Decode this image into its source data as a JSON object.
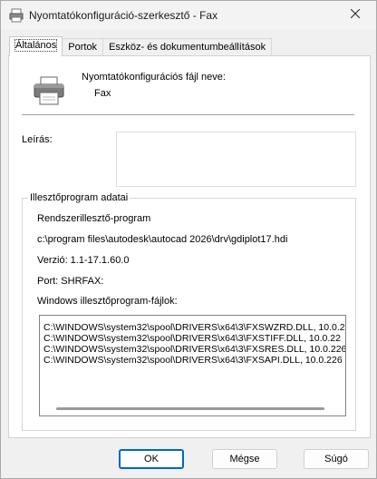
{
  "window": {
    "title": "Nyomtatókonfiguráció-szerkesztő - Fax"
  },
  "tabs": [
    {
      "label": "Általános"
    },
    {
      "label": "Portok"
    },
    {
      "label": "Eszköz- és dokumentumbeállítások"
    }
  ],
  "general": {
    "file_name_label": "Nyomtatókonfigurációs fájl neve:",
    "file_name_value": "Fax",
    "description_label": "Leírás:",
    "description_value": ""
  },
  "driver_group": {
    "title": "Illesztőprogram adatai",
    "driver_type": "Rendszerillesztő-program",
    "driver_path": "c:\\program files\\autodesk\\autocad 2026\\drv\\gdiplot17.hdi",
    "version": "Verzió: 1.1-17.1.60.0",
    "port": "Port: SHRFAX:",
    "files_label": "Windows illesztőprogram-fájlok:",
    "files": [
      "C:\\WINDOWS\\system32\\spool\\DRIVERS\\x64\\3\\FXSWZRD.DLL, 10.0.2",
      "C:\\WINDOWS\\system32\\spool\\DRIVERS\\x64\\3\\FXSTIFF.DLL, 10.0.22",
      "C:\\WINDOWS\\system32\\spool\\DRIVERS\\x64\\3\\FXSRES.DLL, 10.0.226",
      "C:\\WINDOWS\\system32\\spool\\DRIVERS\\x64\\3\\FXSAPI.DLL, 10.0.226"
    ]
  },
  "buttons": {
    "ok": "OK",
    "cancel": "Mégse",
    "help": "Súgó"
  },
  "icons": {
    "title": "printer-config-icon",
    "close": "close-icon",
    "printer": "printer-icon"
  },
  "colors": {
    "accent": "#0067c0"
  }
}
